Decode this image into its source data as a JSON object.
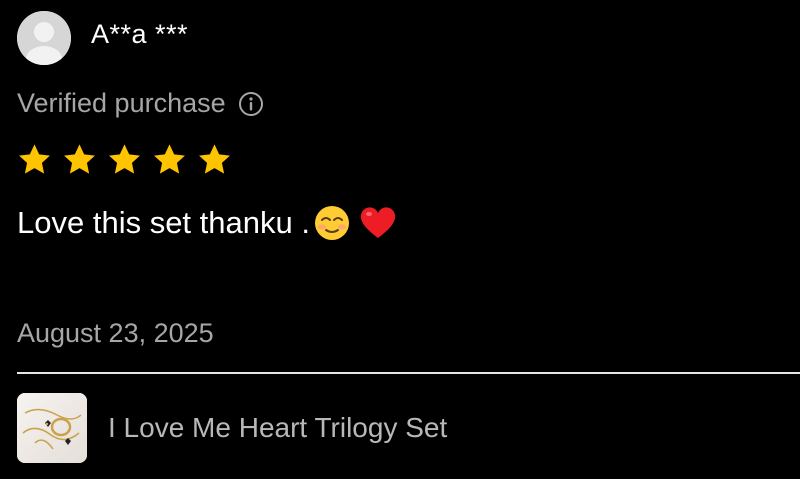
{
  "review": {
    "user": {
      "name": "A**a ***",
      "avatar_icon": "default-user-avatar"
    },
    "verified_label": "Verified purchase",
    "verified_icon": "info-icon",
    "rating": 5,
    "rating_max": 5,
    "star_color": "#ffc400",
    "comment": "Love this set thanku .",
    "comment_emojis": [
      "smiling-face-icon",
      "red-heart-icon"
    ],
    "date": "August 23, 2025"
  },
  "product": {
    "name": "I Love Me Heart Trilogy Set",
    "thumbnail_icon": "jewelry-product-thumbnail"
  },
  "colors": {
    "background": "#000000",
    "primary_text": "#ffffff",
    "secondary_text": "#a6a6a6",
    "divider": "#e6e6e6"
  }
}
